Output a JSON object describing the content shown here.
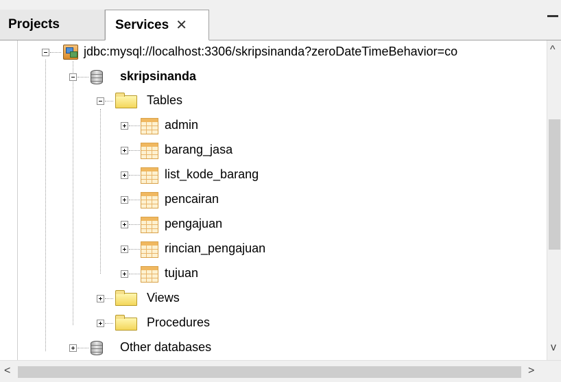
{
  "tabs": [
    {
      "label": "Projects",
      "active": false
    },
    {
      "label": "Services",
      "active": true,
      "close": "✕"
    }
  ],
  "tree": {
    "connection": "jdbc:mysql://localhost:3306/skripsinanda?zeroDateTimeBehavior=co",
    "database": "skripsinanda",
    "tables_folder": "Tables",
    "tables": [
      "admin",
      "barang_jasa",
      "list_kode_barang",
      "pencairan",
      "pengajuan",
      "rincian_pengajuan",
      "tujuan"
    ],
    "views_folder": "Views",
    "procedures_folder": "Procedures",
    "other_databases": "Other databases"
  },
  "scroll": {
    "up": "^",
    "down": "v",
    "left": "<",
    "right": ">"
  }
}
